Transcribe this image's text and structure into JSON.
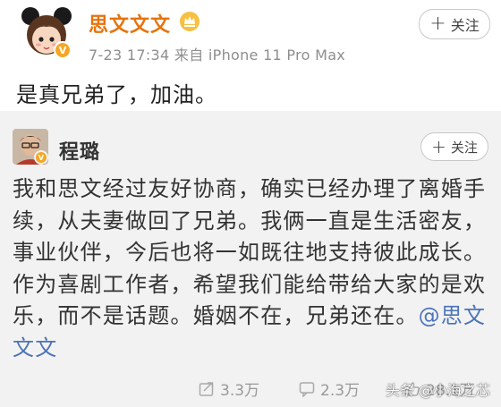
{
  "post": {
    "username": "思文文文",
    "meta": "7-23 17:34  来自 iPhone 11 Pro Max",
    "follow_label": "关注",
    "content": "是真兄弟了，加油。"
  },
  "repost": {
    "username": "程璐",
    "follow_label": "关注",
    "text": "我和思文经过友好协商，确实已经办理了离婚手续，从夫妻做回了兄弟。我俩一直是生活密友，事业伙伴，今后也将一如既往地支持彼此成长。作为喜剧工作者，希望我们能给带给大家的是欢乐，而不是话题。婚姻不在，兄弟还在。",
    "mention": "@思文文文",
    "actions": {
      "repost_count": "3.3万",
      "comment_count": "2.3万",
      "like_count": "28.1万"
    }
  },
  "watermark": "头条 @小海之芯",
  "colors": {
    "username_orange": "#e8730c",
    "mention_blue": "#4b73b8",
    "repost_bg": "#f2f2f2",
    "vip_gold": "#f5a623"
  },
  "icons": [
    "avatar-cartoon",
    "vip-badge",
    "crown-icon",
    "plus-icon",
    "repost-icon",
    "comment-icon",
    "like-icon"
  ]
}
